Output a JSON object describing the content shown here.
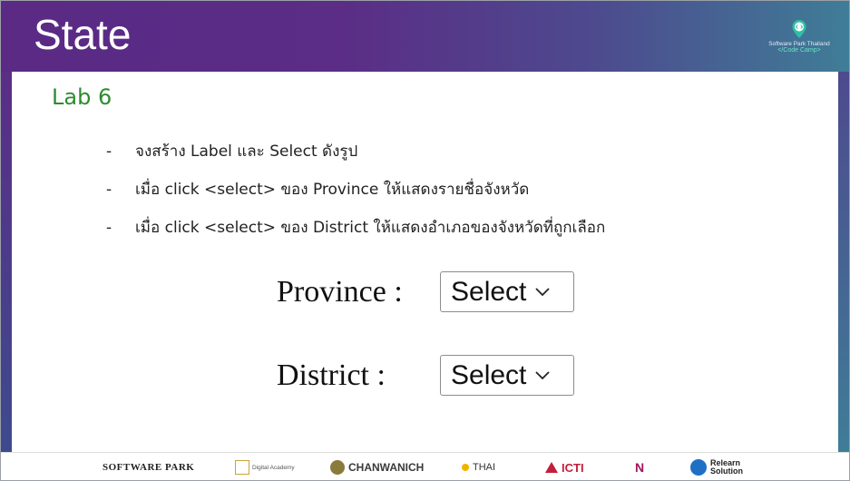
{
  "header": {
    "title": "State",
    "logo_line1": "Software Park Thailand",
    "logo_line2": "</Code Camp>"
  },
  "lab_title": "Lab 6",
  "bullets": [
    {
      "marker": "-",
      "text": "จงสร้าง Label และ Select ดังรูป"
    },
    {
      "marker": "-",
      "text": "เมื่อ click <select> ของ Province ให้แสดงรายชื่อจังหวัด"
    },
    {
      "marker": "-",
      "text": "เมื่อ click <select> ของ District ให้แสดงอำเภอของจังหวัดที่ถูกเลือก"
    }
  ],
  "form": {
    "province": {
      "label": "Province :",
      "value": "Select"
    },
    "district": {
      "label": "District :",
      "value": "Select"
    }
  },
  "footer": {
    "software_park": "SOFTWARE PARK",
    "digital_academy": "Digital Academy",
    "chanwanich": "CHANWANICH",
    "thai_programmer": "THAI",
    "icti": "ICTI",
    "n_logo": "N",
    "relearn_line1": "Relearn",
    "relearn_line2": "Solution"
  },
  "colors": {
    "header_start": "#5a2a85",
    "header_end": "#3f7d97",
    "lab_title": "#2e8b2e"
  }
}
